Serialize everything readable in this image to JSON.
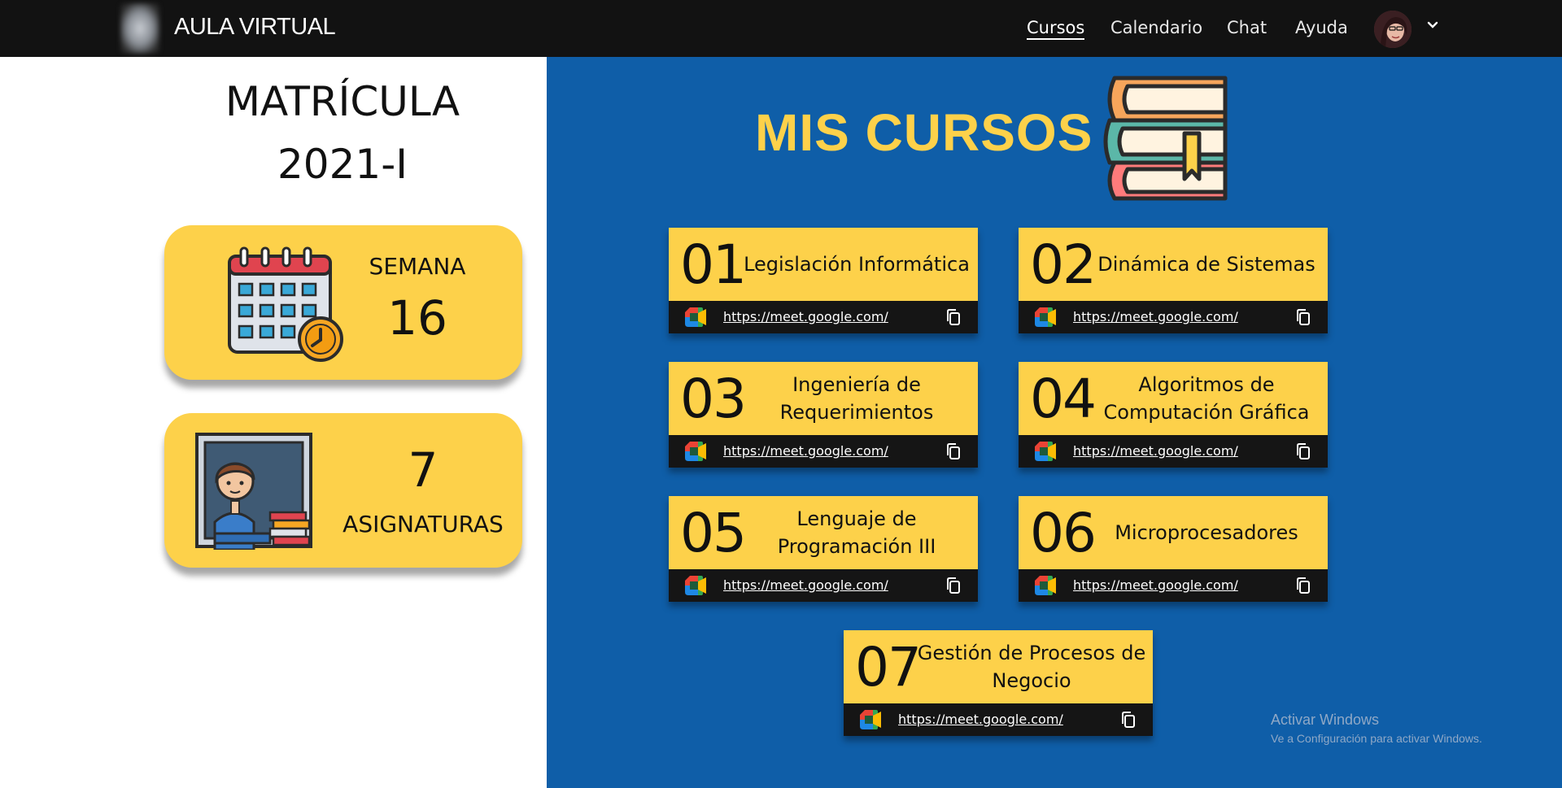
{
  "header": {
    "brand": "AULA VIRTUAL",
    "nav": [
      "Cursos",
      "Calendario",
      "Chat",
      "Ayuda"
    ],
    "active_nav": "Cursos"
  },
  "enrollment": {
    "title_line1": "MATRÍCULA",
    "title_line2": "2021-I",
    "week_label": "SEMANA",
    "week_value": "16",
    "subjects_value": "7",
    "subjects_label": "ASIGNATURAS"
  },
  "courses_section": {
    "title": "MIS CURSOS",
    "courses": [
      {
        "num": "01",
        "name": "Legislación Informática",
        "link": "https://meet.google.com/"
      },
      {
        "num": "02",
        "name": "Dinámica de Sistemas",
        "link": "https://meet.google.com/"
      },
      {
        "num": "03",
        "name": "Ingeniería de Requerimientos",
        "link": "https://meet.google.com/"
      },
      {
        "num": "04",
        "name": "Algoritmos de Computación Gráfica",
        "link": "https://meet.google.com/"
      },
      {
        "num": "05",
        "name": "Lenguaje de Programación III",
        "link": "https://meet.google.com/"
      },
      {
        "num": "06",
        "name": "Microprocesadores",
        "link": "https://meet.google.com/"
      },
      {
        "num": "07",
        "name": "Gestión de Procesos de Negocio",
        "link": "https://meet.google.com/"
      }
    ]
  },
  "watermark": {
    "line1": "Activar Windows",
    "line2": "Ve a Configuración para activar Windows."
  },
  "colors": {
    "topbar": "#121212",
    "panel_blue": "#0f5ea8",
    "accent_yellow": "#fdd14a"
  },
  "icons": [
    "logo",
    "avatar",
    "chevron-down-icon",
    "calendar-clock-icon",
    "teacher-icon",
    "books-icon",
    "google-meet-icon",
    "copy-icon"
  ]
}
